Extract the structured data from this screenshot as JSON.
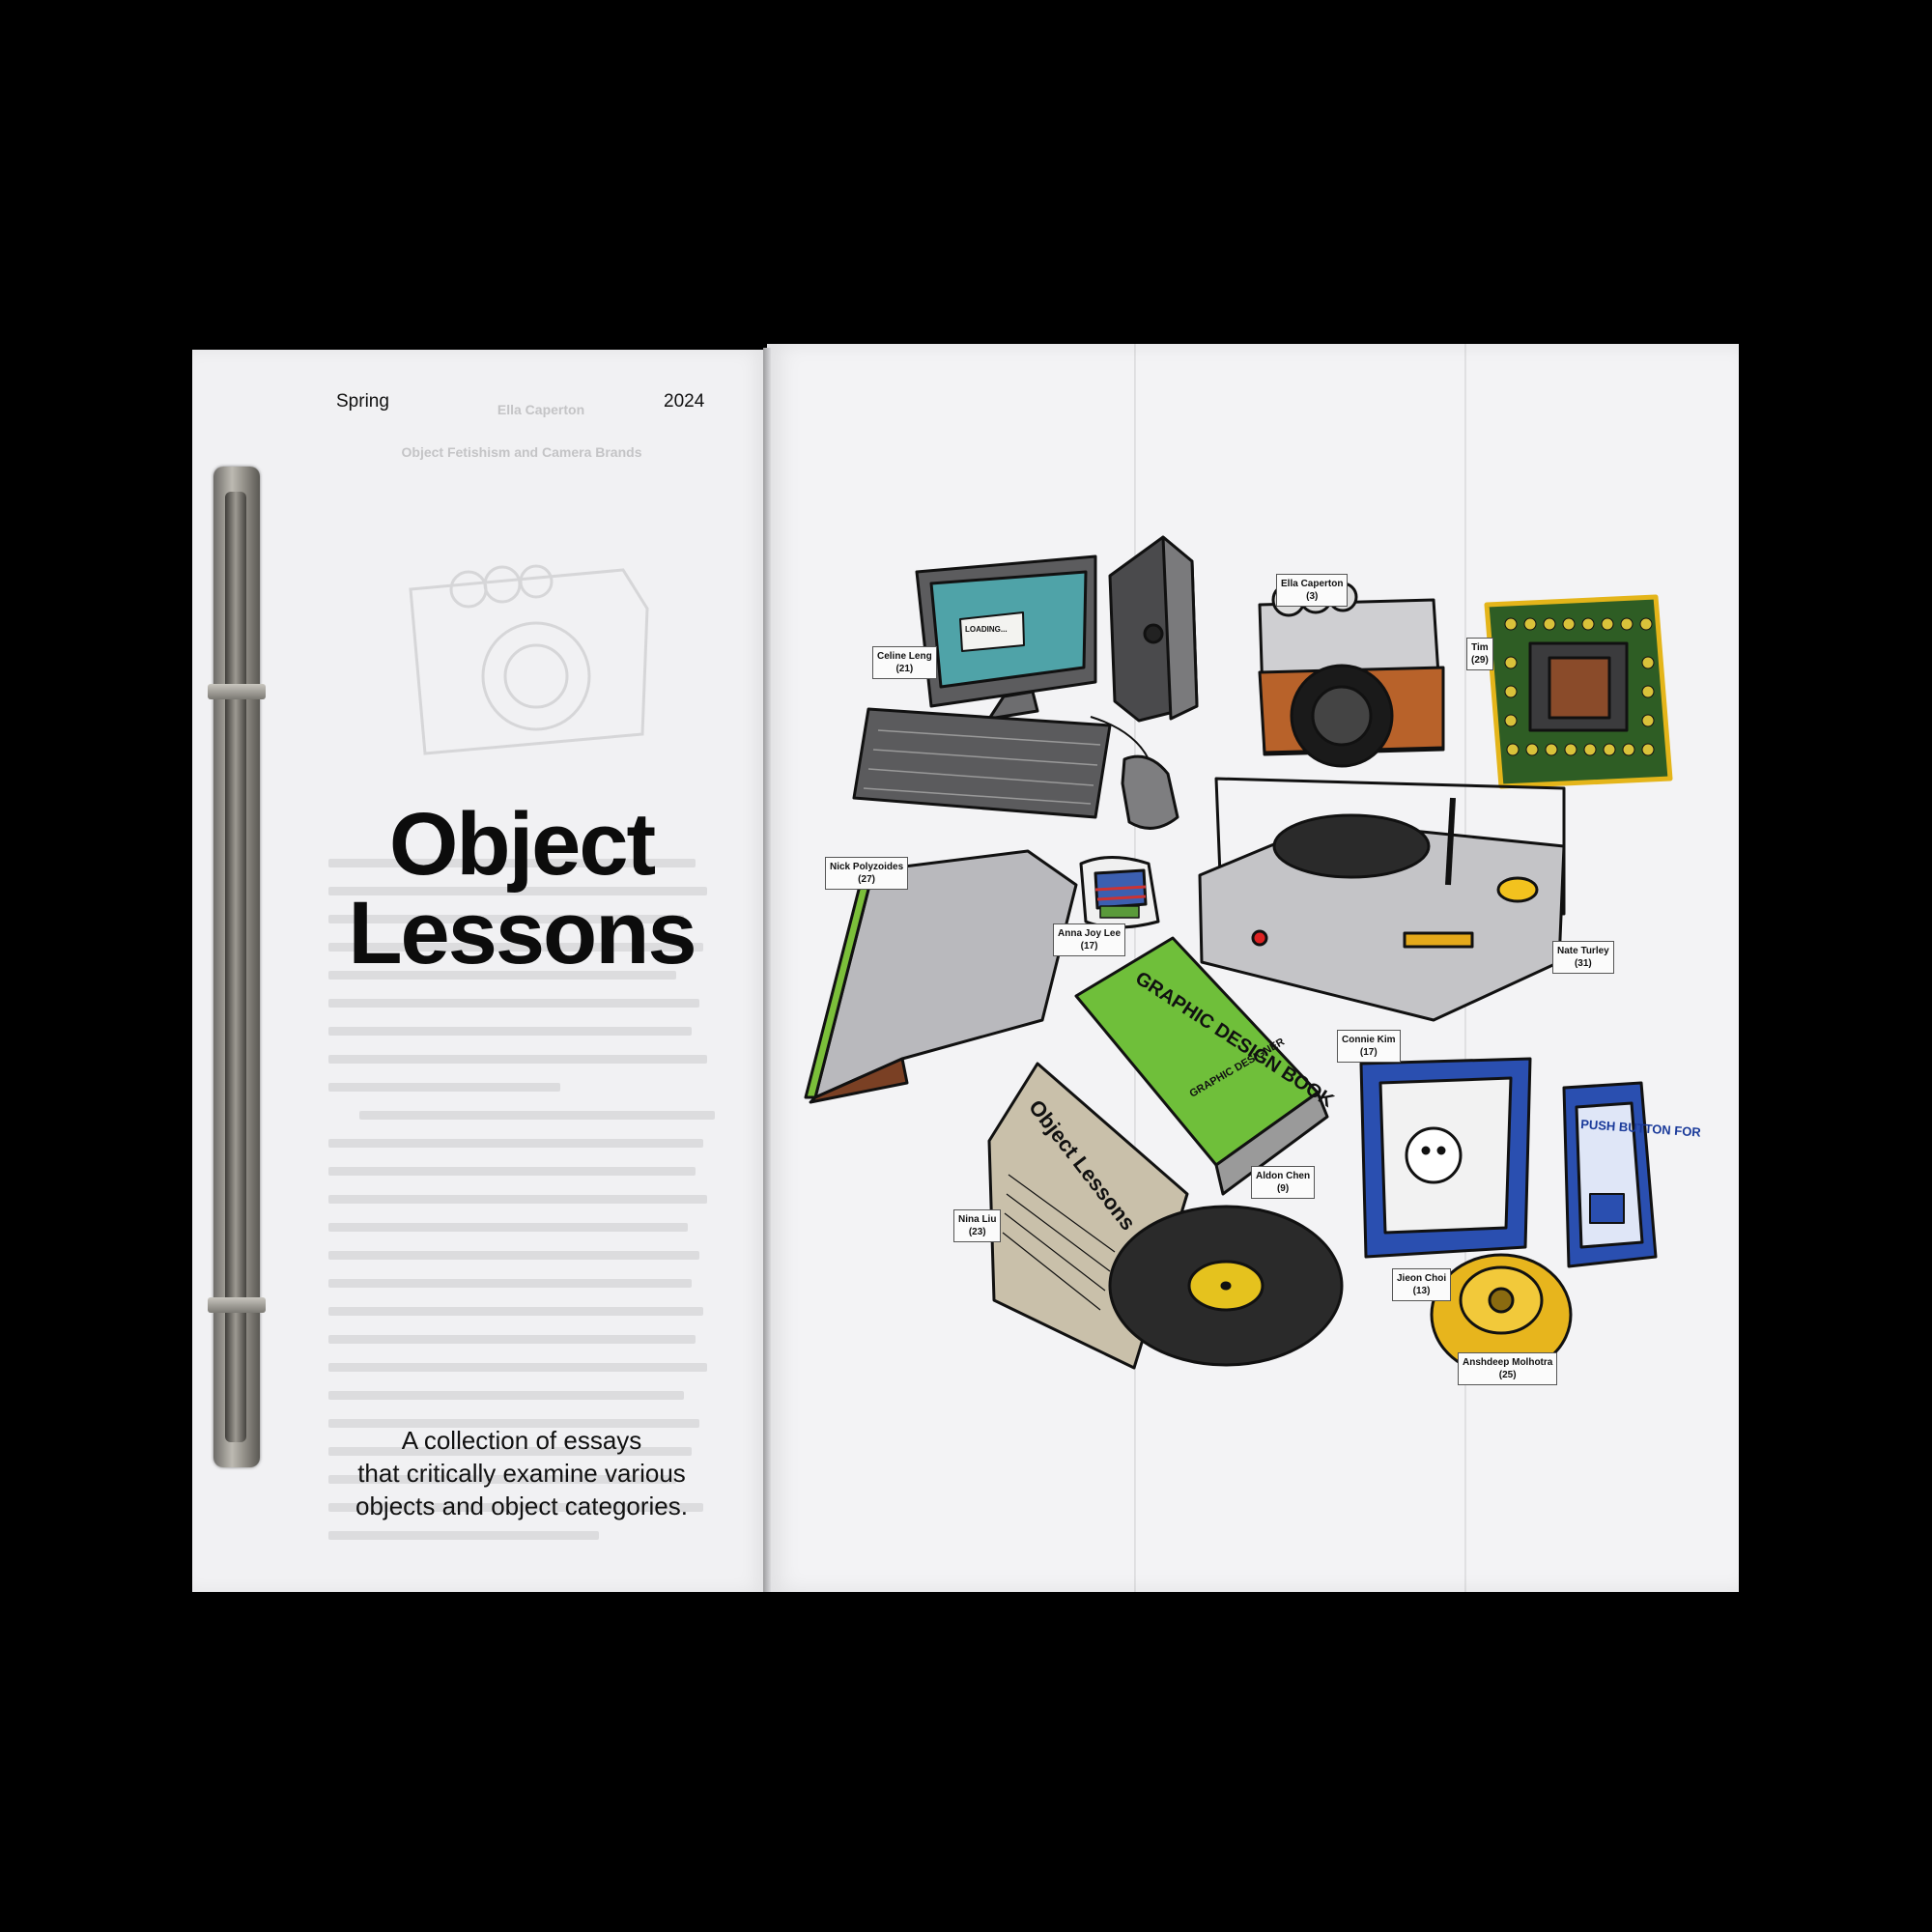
{
  "cover": {
    "season": "Spring",
    "year": "2024",
    "title_line1": "Object",
    "title_line2": "Lessons",
    "subtitle_line1": "A collection of essays",
    "subtitle_line2": "that critically examine various",
    "subtitle_line3": "objects and object categories."
  },
  "showthrough": {
    "author": "Ella Caperton",
    "essay_title": "Object Fetishism and Camera Brands"
  },
  "illustration_labels": [
    {
      "name": "Celine Leng",
      "page": "(21)"
    },
    {
      "name": "Ella Caperton",
      "page": "(3)"
    },
    {
      "name": "Tim",
      "page": "(29)"
    },
    {
      "name": "Nick Polyzoides",
      "page": "(27)"
    },
    {
      "name": "Anna Joy Lee",
      "page": "(17)"
    },
    {
      "name": "Nate Turley",
      "page": "(31)"
    },
    {
      "name": "Connie Kim",
      "page": "(17)"
    },
    {
      "name": "Aldon Chen",
      "page": "(9)"
    },
    {
      "name": "Nina Liu",
      "page": "(23)"
    },
    {
      "name": "Jieon Choi",
      "page": "(13)"
    },
    {
      "name": "Anshdeep Molhotra",
      "page": "(25)"
    }
  ],
  "drawn_text": {
    "screen_text": "LOADING...",
    "book_title": "GRAPHIC DESIGN BOOK",
    "book_spine": "GRAPHIC DESIGNER",
    "newspaper_title": "Object Lessons",
    "sign_text": "PUSH BUTTON FOR"
  },
  "colors": {
    "background": "#000000",
    "paper": "#f2f2f4",
    "screen": "#4fa3a8",
    "camera_leather": "#b8622a",
    "cpu_board": "#2e5d24",
    "book_green": "#6fbf3a",
    "blue_card": "#2a4fb0",
    "record_label": "#e5c21e"
  }
}
